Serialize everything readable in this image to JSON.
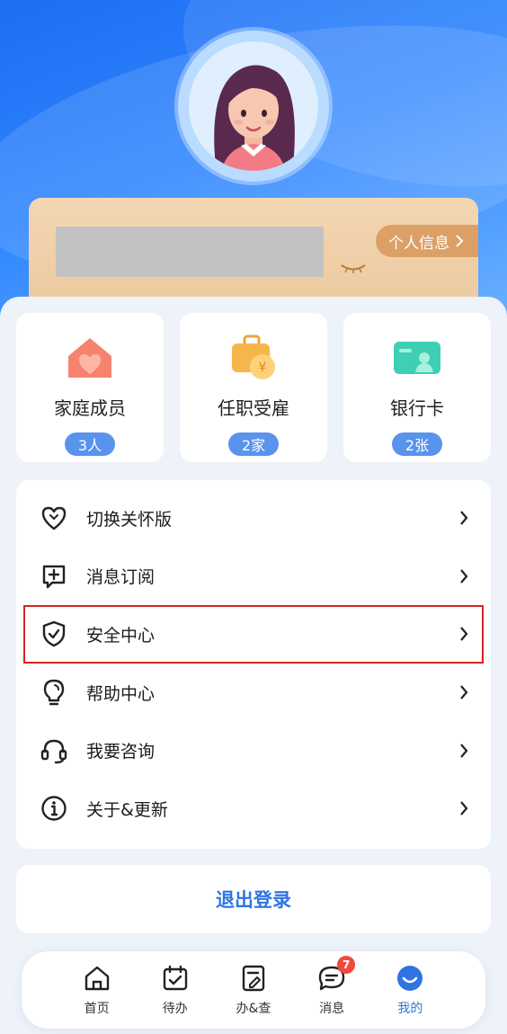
{
  "card": {
    "info_button_label": "个人信息"
  },
  "tiles": [
    {
      "label": "家庭成员",
      "badge": "3人",
      "icon": "family-house-icon"
    },
    {
      "label": "任职受雇",
      "badge": "2家",
      "icon": "briefcase-coin-icon"
    },
    {
      "label": "银行卡",
      "badge": "2张",
      "icon": "bank-card-icon"
    }
  ],
  "menu": [
    {
      "label": "切换关怀版",
      "icon": "heart-icon"
    },
    {
      "label": "消息订阅",
      "icon": "message-subscribe-icon"
    },
    {
      "label": "安全中心",
      "icon": "shield-check-icon"
    },
    {
      "label": "帮助中心",
      "icon": "lightbulb-icon"
    },
    {
      "label": "我要咨询",
      "icon": "headset-icon"
    },
    {
      "label": "关于&更新",
      "icon": "info-icon"
    }
  ],
  "logout_label": "退出登录",
  "tabbar": {
    "items": [
      {
        "label": "首页",
        "icon": "home-icon"
      },
      {
        "label": "待办",
        "icon": "calendar-check-icon"
      },
      {
        "label": "办&查",
        "icon": "document-edit-icon"
      },
      {
        "label": "消息",
        "icon": "chat-icon",
        "badge": "7"
      },
      {
        "label": "我的",
        "icon": "smile-icon"
      }
    ]
  },
  "colors": {
    "accent": "#2f74e0",
    "badge_bg": "#5a93ec",
    "highlight": "#d32424",
    "card": "#ebc79c",
    "notify": "#f0493e"
  }
}
